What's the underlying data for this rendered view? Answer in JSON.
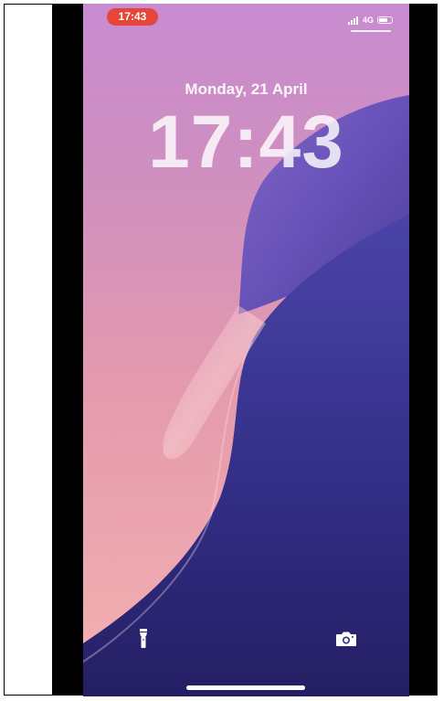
{
  "status_bar": {
    "time_pill": "17:43",
    "network": "4G",
    "colors": {
      "pill": "#e6453a"
    }
  },
  "lock_screen": {
    "date": "Monday, 21 April",
    "time": "17:43"
  },
  "quick_actions": {
    "left_icon": "flashlight-icon",
    "right_icon": "camera-icon"
  },
  "colors": {
    "wallpaper_pink": "#e8a0b6",
    "wallpaper_purple": "#6a55c0",
    "wallpaper_navy": "#2f2b7a"
  }
}
